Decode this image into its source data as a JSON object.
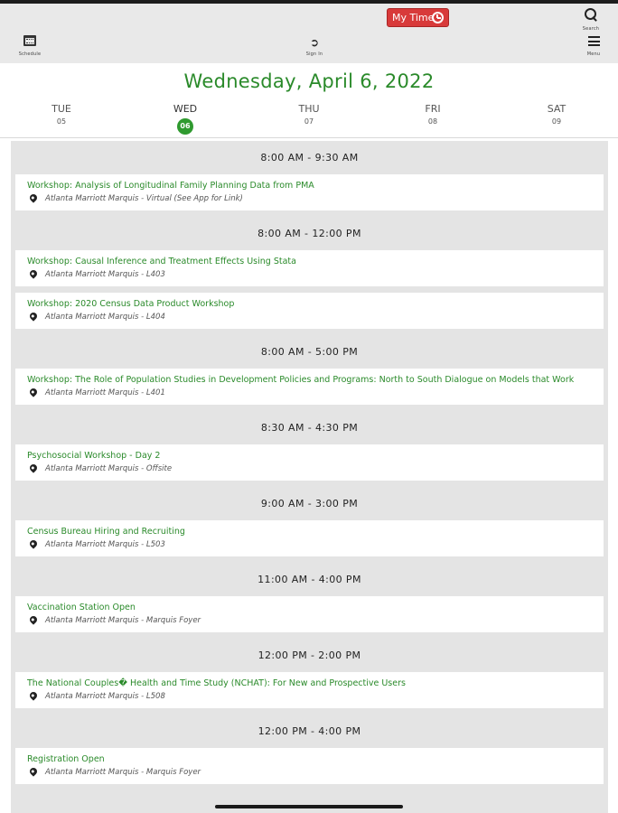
{
  "header": {
    "my_time_label": "My Time",
    "schedule_label": "Schedule",
    "sign_in_label": "Sign In",
    "search_label": "Search",
    "menu_label": "Menu",
    "icons": [
      "calendar-icon",
      "sign-in-icon",
      "search-icon",
      "menu-icon",
      "clock-icon"
    ]
  },
  "date_title": "Wednesday, April 6, 2022",
  "days": [
    {
      "name": "TUE",
      "date": "05"
    },
    {
      "name": "WED",
      "date": "06"
    },
    {
      "name": "THU",
      "date": "07"
    },
    {
      "name": "FRI",
      "date": "08"
    },
    {
      "name": "SAT",
      "date": "09"
    }
  ],
  "selected_day": "WED",
  "colors": {
    "accent_green": "#2a8a2a",
    "my_time_red": "#d83a3a",
    "list_bg": "#e4e4e4"
  },
  "schedule": [
    {
      "time": "8:00 AM - 9:30 AM",
      "events": [
        {
          "title": "Workshop: Analysis of Longitudinal Family Planning Data from PMA",
          "location": "Atlanta Marriott Marquis - Virtual (See App for Link)"
        }
      ]
    },
    {
      "time": "8:00 AM - 12:00 PM",
      "events": [
        {
          "title": "Workshop: Causal Inference and Treatment Effects Using Stata",
          "location": "Atlanta Marriott Marquis - L403"
        },
        {
          "title": "Workshop: 2020 Census Data Product Workshop",
          "location": "Atlanta Marriott Marquis - L404"
        }
      ]
    },
    {
      "time": "8:00 AM - 5:00 PM",
      "events": [
        {
          "title": "Workshop: The Role of Population Studies in Development Policies and Programs: North to South Dialogue on Models that Work",
          "location": "Atlanta Marriott Marquis - L401"
        }
      ]
    },
    {
      "time": "8:30 AM - 4:30 PM",
      "events": [
        {
          "title": "Psychosocial Workshop - Day 2",
          "location": "Atlanta Marriott Marquis - Offsite"
        }
      ]
    },
    {
      "time": "9:00 AM - 3:00 PM",
      "events": [
        {
          "title": "Census Bureau Hiring and Recruiting",
          "location": "Atlanta Marriott Marquis - L503"
        }
      ]
    },
    {
      "time": "11:00 AM - 4:00 PM",
      "events": [
        {
          "title": "Vaccination Station Open",
          "location": "Atlanta Marriott Marquis - Marquis Foyer"
        }
      ]
    },
    {
      "time": "12:00 PM - 2:00 PM",
      "events": [
        {
          "title": "The National Couples� Health and Time Study (NCHAT): For New and Prospective Users",
          "location": "Atlanta Marriott Marquis - L508"
        }
      ]
    },
    {
      "time": "12:00 PM - 4:00 PM",
      "events": [
        {
          "title": "Registration Open",
          "location": "Atlanta Marriott Marquis - Marquis Foyer"
        }
      ]
    }
  ]
}
